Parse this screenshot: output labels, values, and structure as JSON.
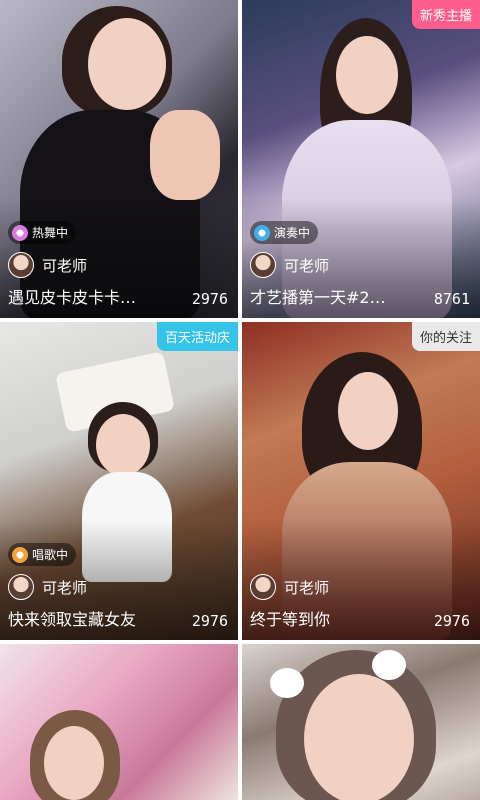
{
  "cards": [
    {
      "tag": "",
      "status": "热舞中",
      "host": "可老师",
      "title": "遇见皮卡皮卡卡…",
      "count": "2976"
    },
    {
      "tag": "新秀主播",
      "status": "演奏中",
      "host": "可老师",
      "title": "才艺播第一天#2…",
      "count": "8761"
    },
    {
      "tag": "百天活动庆",
      "status": "唱歌中",
      "host": "可老师",
      "title": "快来领取宝藏女友",
      "count": "2976"
    },
    {
      "tag": "你的关注",
      "status": "",
      "host": "可老师",
      "title": "终于等到你",
      "count": "2976"
    },
    {
      "tag": "",
      "status": "",
      "host": "",
      "title": "",
      "count": ""
    },
    {
      "tag": "",
      "status": "",
      "host": "",
      "title": "",
      "count": ""
    }
  ],
  "colors": {
    "tag_pink": "#ff5e8c",
    "tag_cyan": "#35c3e7",
    "tag_gray": "#e9e9e9"
  },
  "icons": {
    "dance": "dance-status-icon",
    "play": "instrument-status-icon",
    "sing": "microphone-status-icon"
  }
}
